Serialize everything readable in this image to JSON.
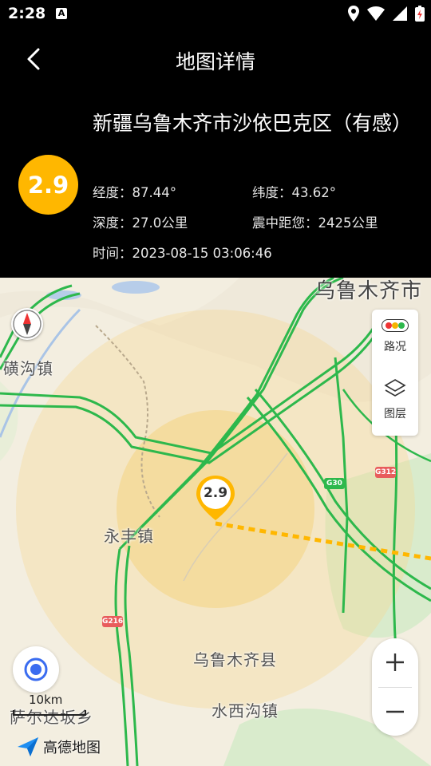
{
  "status": {
    "time": "2:28",
    "notif_icon": "A"
  },
  "header": {
    "title": "地图详情"
  },
  "earthquake": {
    "magnitude": "2.9",
    "title": "新疆乌鲁木齐市沙依巴克区（有感）",
    "longitude": "经度：87.44°",
    "latitude": "纬度：43.62°",
    "depth": "深度：27.0公里",
    "distance": "震中距您：2425公里",
    "time": "时间：2023-08-15 03:06:46"
  },
  "map": {
    "labels": {
      "city": "乌鲁木齐市",
      "kuanggou": "磺沟镇",
      "yongfeng": "永丰镇",
      "county": "乌鲁木齐县",
      "saerdaban": "萨尔达坂乡",
      "shuixigou": "水西沟镇"
    },
    "road_shields": {
      "g30": "G30",
      "g312": "G312",
      "g216": "G216"
    },
    "pin_magnitude": "2.9",
    "tools": {
      "traffic": "路况",
      "layers": "图层"
    },
    "scale": "10km",
    "brand": "高德地图"
  },
  "colors": {
    "accent": "#FFB700",
    "route": "#2DB84C",
    "distance_line": "#FFB700"
  }
}
